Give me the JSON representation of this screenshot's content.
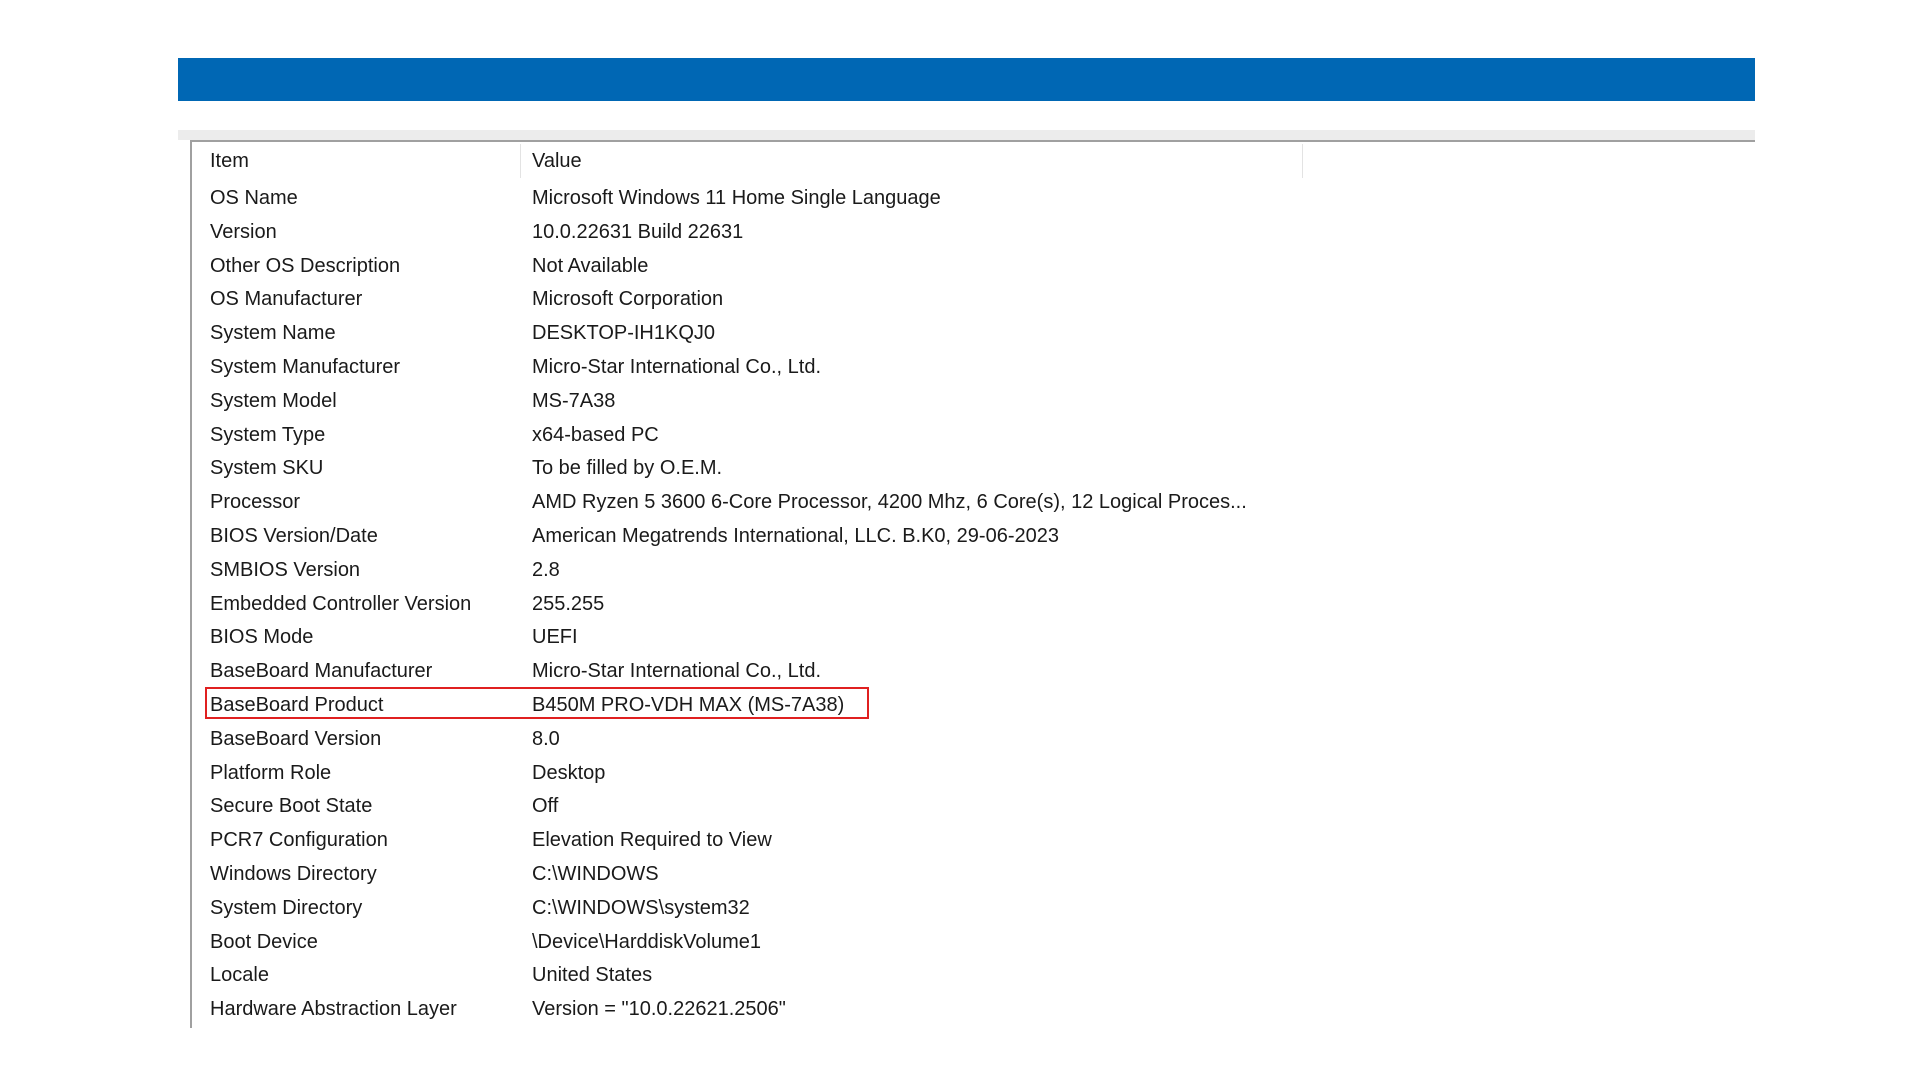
{
  "table": {
    "headers": {
      "item": "Item",
      "value": "Value"
    },
    "rows": [
      {
        "item": "OS Name",
        "value": "Microsoft Windows 11 Home Single Language"
      },
      {
        "item": "Version",
        "value": "10.0.22631 Build 22631"
      },
      {
        "item": "Other OS Description",
        "value": "Not Available"
      },
      {
        "item": "OS Manufacturer",
        "value": "Microsoft Corporation"
      },
      {
        "item": "System Name",
        "value": "DESKTOP-IH1KQJ0"
      },
      {
        "item": "System Manufacturer",
        "value": "Micro-Star International Co., Ltd."
      },
      {
        "item": "System Model",
        "value": "MS-7A38"
      },
      {
        "item": "System Type",
        "value": "x64-based PC"
      },
      {
        "item": "System SKU",
        "value": "To be filled by O.E.M."
      },
      {
        "item": "Processor",
        "value": "AMD Ryzen 5 3600 6-Core Processor, 4200 Mhz, 6 Core(s), 12 Logical Proces..."
      },
      {
        "item": "BIOS Version/Date",
        "value": "American Megatrends International, LLC. B.K0, 29-06-2023"
      },
      {
        "item": "SMBIOS Version",
        "value": "2.8"
      },
      {
        "item": "Embedded Controller Version",
        "value": "255.255"
      },
      {
        "item": "BIOS Mode",
        "value": "UEFI"
      },
      {
        "item": "BaseBoard Manufacturer",
        "value": "Micro-Star International Co., Ltd."
      },
      {
        "item": "BaseBoard Product",
        "value": "B450M PRO-VDH MAX (MS-7A38)"
      },
      {
        "item": "BaseBoard Version",
        "value": "8.0"
      },
      {
        "item": "Platform Role",
        "value": "Desktop"
      },
      {
        "item": "Secure Boot State",
        "value": "Off"
      },
      {
        "item": "PCR7 Configuration",
        "value": "Elevation Required to View"
      },
      {
        "item": "Windows Directory",
        "value": "C:\\WINDOWS"
      },
      {
        "item": "System Directory",
        "value": "C:\\WINDOWS\\system32"
      },
      {
        "item": "Boot Device",
        "value": "\\Device\\HarddiskVolume1"
      },
      {
        "item": "Locale",
        "value": "United States"
      },
      {
        "item": "Hardware Abstraction Layer",
        "value": "Version = \"10.0.22621.2506\""
      }
    ]
  },
  "colors": {
    "title_bar": "#0067b4",
    "highlight_border": "#e02020"
  }
}
